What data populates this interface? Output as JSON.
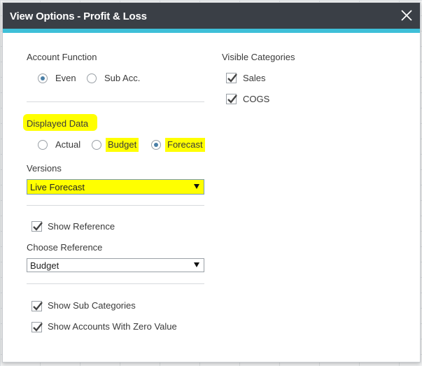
{
  "dialog": {
    "title": "View Options - Profit & Loss"
  },
  "account_function": {
    "label": "Account Function",
    "options": [
      {
        "label": "Even",
        "selected": true
      },
      {
        "label": "Sub Acc.",
        "selected": false
      }
    ]
  },
  "displayed_data": {
    "label": "Displayed Data",
    "options": [
      {
        "label": "Actual",
        "selected": false
      },
      {
        "label": "Budget",
        "selected": false
      },
      {
        "label": "Forecast",
        "selected": true
      }
    ]
  },
  "versions": {
    "label": "Versions",
    "value": "Live Forecast"
  },
  "reference": {
    "show_label": "Show Reference",
    "show_checked": true,
    "choose_label": "Choose Reference",
    "value": "Budget"
  },
  "options": {
    "show_sub_categories": {
      "label": "Show Sub Categories",
      "checked": true
    },
    "show_zero_accounts": {
      "label": "Show Accounts With Zero Value",
      "checked": true
    }
  },
  "visible_categories": {
    "label": "Visible Categories",
    "items": [
      {
        "label": "Sales",
        "checked": true
      },
      {
        "label": "COGS",
        "checked": true
      }
    ]
  },
  "colors": {
    "titlebar": "#3a3f46",
    "accent": "#3ebfd8",
    "highlight": "#ffff00"
  }
}
